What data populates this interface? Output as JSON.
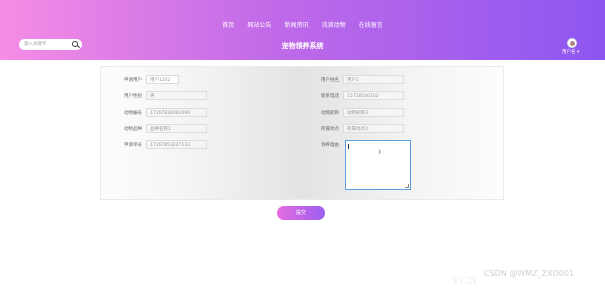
{
  "nav": {
    "items": [
      "首页",
      "网站公告",
      "新闻资讯",
      "流浪动物",
      "在线留言"
    ]
  },
  "search": {
    "placeholder": "输入关键字"
  },
  "system_title": "宠物领养系统",
  "user": {
    "name": "用户名"
  },
  "form": {
    "left": [
      {
        "label": "申请用户",
        "value": "用户1202"
      },
      {
        "label": "用户性别",
        "value": "男"
      },
      {
        "label": "动物编号",
        "value": "17167836081096"
      },
      {
        "label": "动物品种",
        "value": "品种名称1"
      },
      {
        "label": "申请单号",
        "value": "17167853247133"
      }
    ],
    "right": [
      {
        "label": "用户姓名",
        "value": "用户2"
      },
      {
        "label": "联系电话",
        "value": "15718540202"
      },
      {
        "label": "动物昵称",
        "value": "动物昵称3"
      },
      {
        "label": "所属地点",
        "value": "所属地点3"
      },
      {
        "label": "领养理由",
        "value": ""
      }
    ]
  },
  "submit_label": "提交",
  "watermark": "CSDN @WMZ_ZXD001",
  "corner_watermark": "vcn"
}
